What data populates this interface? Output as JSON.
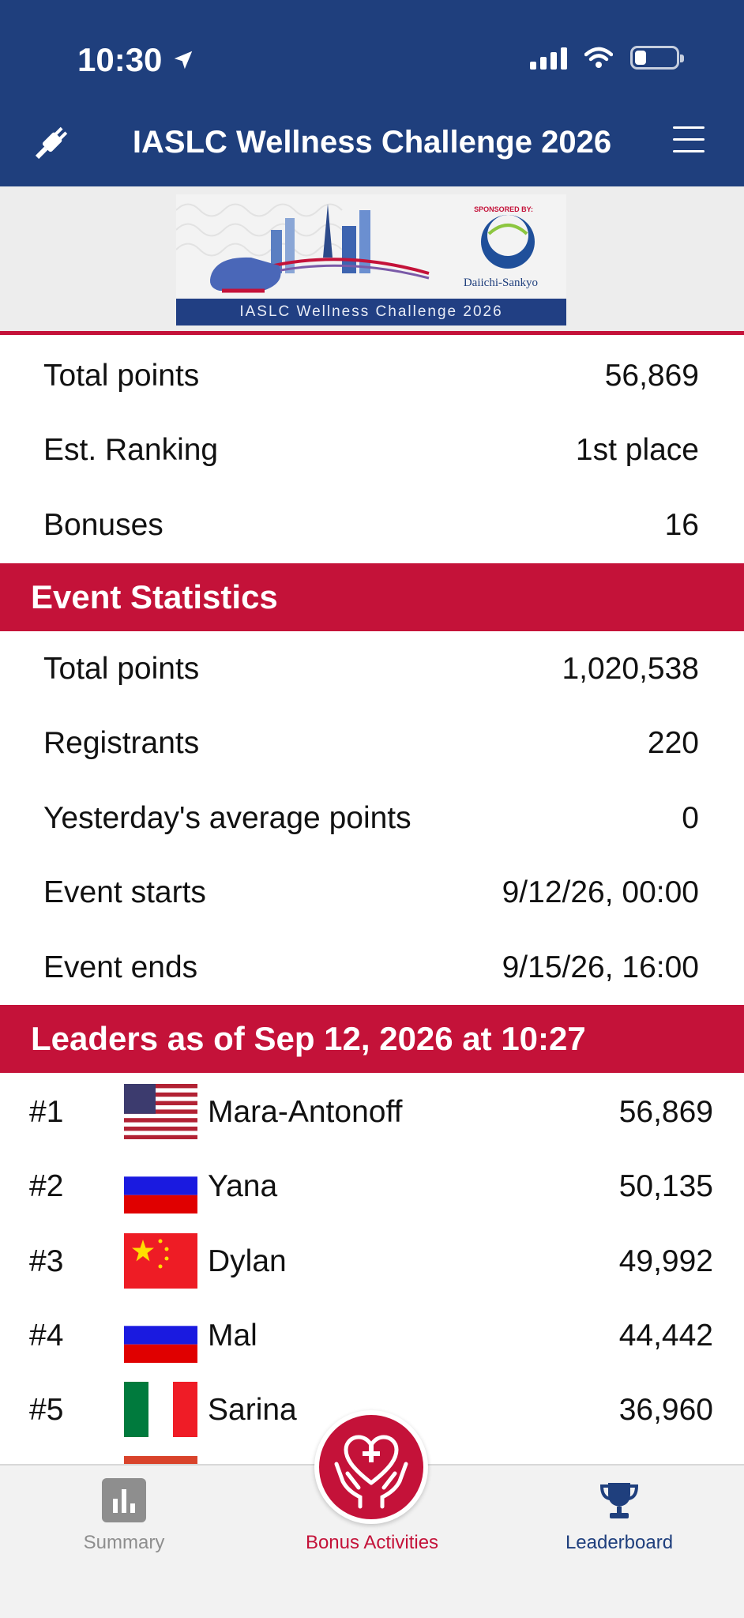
{
  "status_bar": {
    "time": "10:30"
  },
  "header": {
    "title": "IASLC Wellness Challenge 2026"
  },
  "banner": {
    "sponsor_label": "SPONSORED BY:",
    "sponsor_name": "Daiichi-Sankyo",
    "caption": "IASLC Wellness Challenge 2026"
  },
  "personal_stats": [
    {
      "label": "Total points",
      "value": "56,869"
    },
    {
      "label": "Est. Ranking",
      "value": "1st place"
    },
    {
      "label": "Bonuses",
      "value": "16"
    }
  ],
  "event_statistics": {
    "title": "Event Statistics",
    "rows": [
      {
        "label": "Total points",
        "value": "1,020,538"
      },
      {
        "label": "Registrants",
        "value": "220"
      },
      {
        "label": "Yesterday's average points",
        "value": "0"
      },
      {
        "label": "Event starts",
        "value": "9/12/26, 00:00"
      },
      {
        "label": "Event ends",
        "value": "9/15/26, 16:00"
      }
    ]
  },
  "leaders": {
    "title": "Leaders as of Sep 12, 2026 at 10:27",
    "entries": [
      {
        "rank": "#1",
        "flag": "usa-flag",
        "name": "Mara-Antonoff",
        "points": "56,869"
      },
      {
        "rank": "#2",
        "flag": "russia-flag",
        "name": "Yana",
        "points": "50,135"
      },
      {
        "rank": "#3",
        "flag": "china-flag",
        "name": "Dylan",
        "points": "49,992"
      },
      {
        "rank": "#4",
        "flag": "russia-flag",
        "name": "Mal",
        "points": "44,442"
      },
      {
        "rank": "#5",
        "flag": "italy-flag",
        "name": "Sarina",
        "points": "36,960"
      }
    ]
  },
  "tabbar": {
    "summary": "Summary",
    "bonus": "Bonus Activities",
    "leaderboard": "Leaderboard"
  },
  "colors": {
    "header_blue": "#1f3f7d",
    "accent_red": "#c41239",
    "tab_inactive": "#8e8e8e",
    "tab_leaderboard": "#1f3f7d"
  }
}
